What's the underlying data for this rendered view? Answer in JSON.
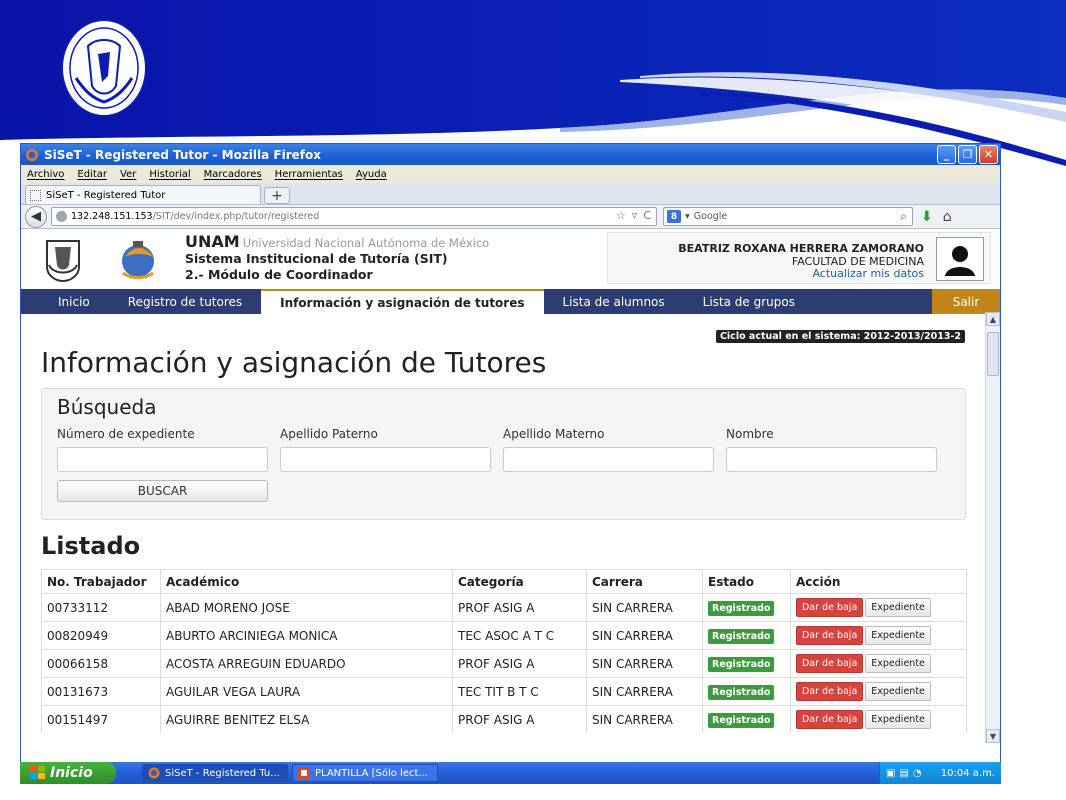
{
  "window": {
    "title": "SiSeT - Registered Tutor - Mozilla Firefox"
  },
  "menu": [
    "Archivo",
    "Editar",
    "Ver",
    "Historial",
    "Marcadores",
    "Herramientas",
    "Ayuda"
  ],
  "tab": {
    "label": "SiSeT - Registered Tutor",
    "new_tab": "+"
  },
  "address": {
    "host": "132.248.151.153",
    "path": "/SIT/dev/index.php/tutor/registered",
    "search_placeholder": "Google"
  },
  "header": {
    "org": "UNAM",
    "org_full": "Universidad Nacional Autónoma de México",
    "system": "Sistema Institucional de Tutoría (SIT)",
    "module": "2.- Módulo de Coordinador"
  },
  "user": {
    "name": "BEATRIZ ROXANA HERRERA ZAMORANO",
    "faculty": "FACULTAD DE MEDICINA",
    "update_link": "Actualizar mis datos"
  },
  "nav": {
    "items": [
      "Inicio",
      "Registro de tutores",
      "Información y asignación de tutores",
      "Lista de alumnos",
      "Lista de grupos"
    ],
    "logout": "Salir"
  },
  "cycle": "Ciclo actual en el sistema: 2012-2013/2013-2",
  "page_title": "Información y asignación de Tutores",
  "search": {
    "title": "Búsqueda",
    "fields": [
      "Número de expediente",
      "Apellido Paterno",
      "Apellido Materno",
      "Nombre"
    ],
    "button": "BUSCAR"
  },
  "list": {
    "title": "Listado",
    "columns": [
      "No. Trabajador",
      "Académico",
      "Categoría",
      "Carrera",
      "Estado",
      "Acción"
    ],
    "rows": [
      {
        "num": "00733112",
        "name": "ABAD MORENO JOSE",
        "cat": "PROF ASIG A",
        "career": "SIN CARRERA",
        "status": "Registrado"
      },
      {
        "num": "00820949",
        "name": "ABURTO ARCINIEGA MONICA",
        "cat": "TEC ASOC A T C",
        "career": "SIN CARRERA",
        "status": "Registrado"
      },
      {
        "num": "00066158",
        "name": "ACOSTA ARREGUIN EDUARDO",
        "cat": "PROF ASIG A",
        "career": "SIN CARRERA",
        "status": "Registrado"
      },
      {
        "num": "00131673",
        "name": "AGUILAR VEGA LAURA",
        "cat": "TEC TIT B T C",
        "career": "SIN CARRERA",
        "status": "Registrado"
      },
      {
        "num": "00151497",
        "name": "AGUIRRE BENITEZ ELSA",
        "cat": "PROF ASIG A",
        "career": "SIN CARRERA",
        "status": "Registrado"
      }
    ],
    "action_drop": "Dar de baja",
    "action_record": "Expediente"
  },
  "taskbar": {
    "start": "Inicio",
    "items": [
      "SiSeT - Registered Tu...",
      "PLANTILLA [Sólo lect..."
    ],
    "clock": "10:04 a.m."
  },
  "colors": {
    "nav_bg": "#2d3c73",
    "logout_bg": "#c0861a",
    "badge_green": "#3e9a3e",
    "btn_red": "#d6443e",
    "banner_blue": "#0a1db0"
  }
}
